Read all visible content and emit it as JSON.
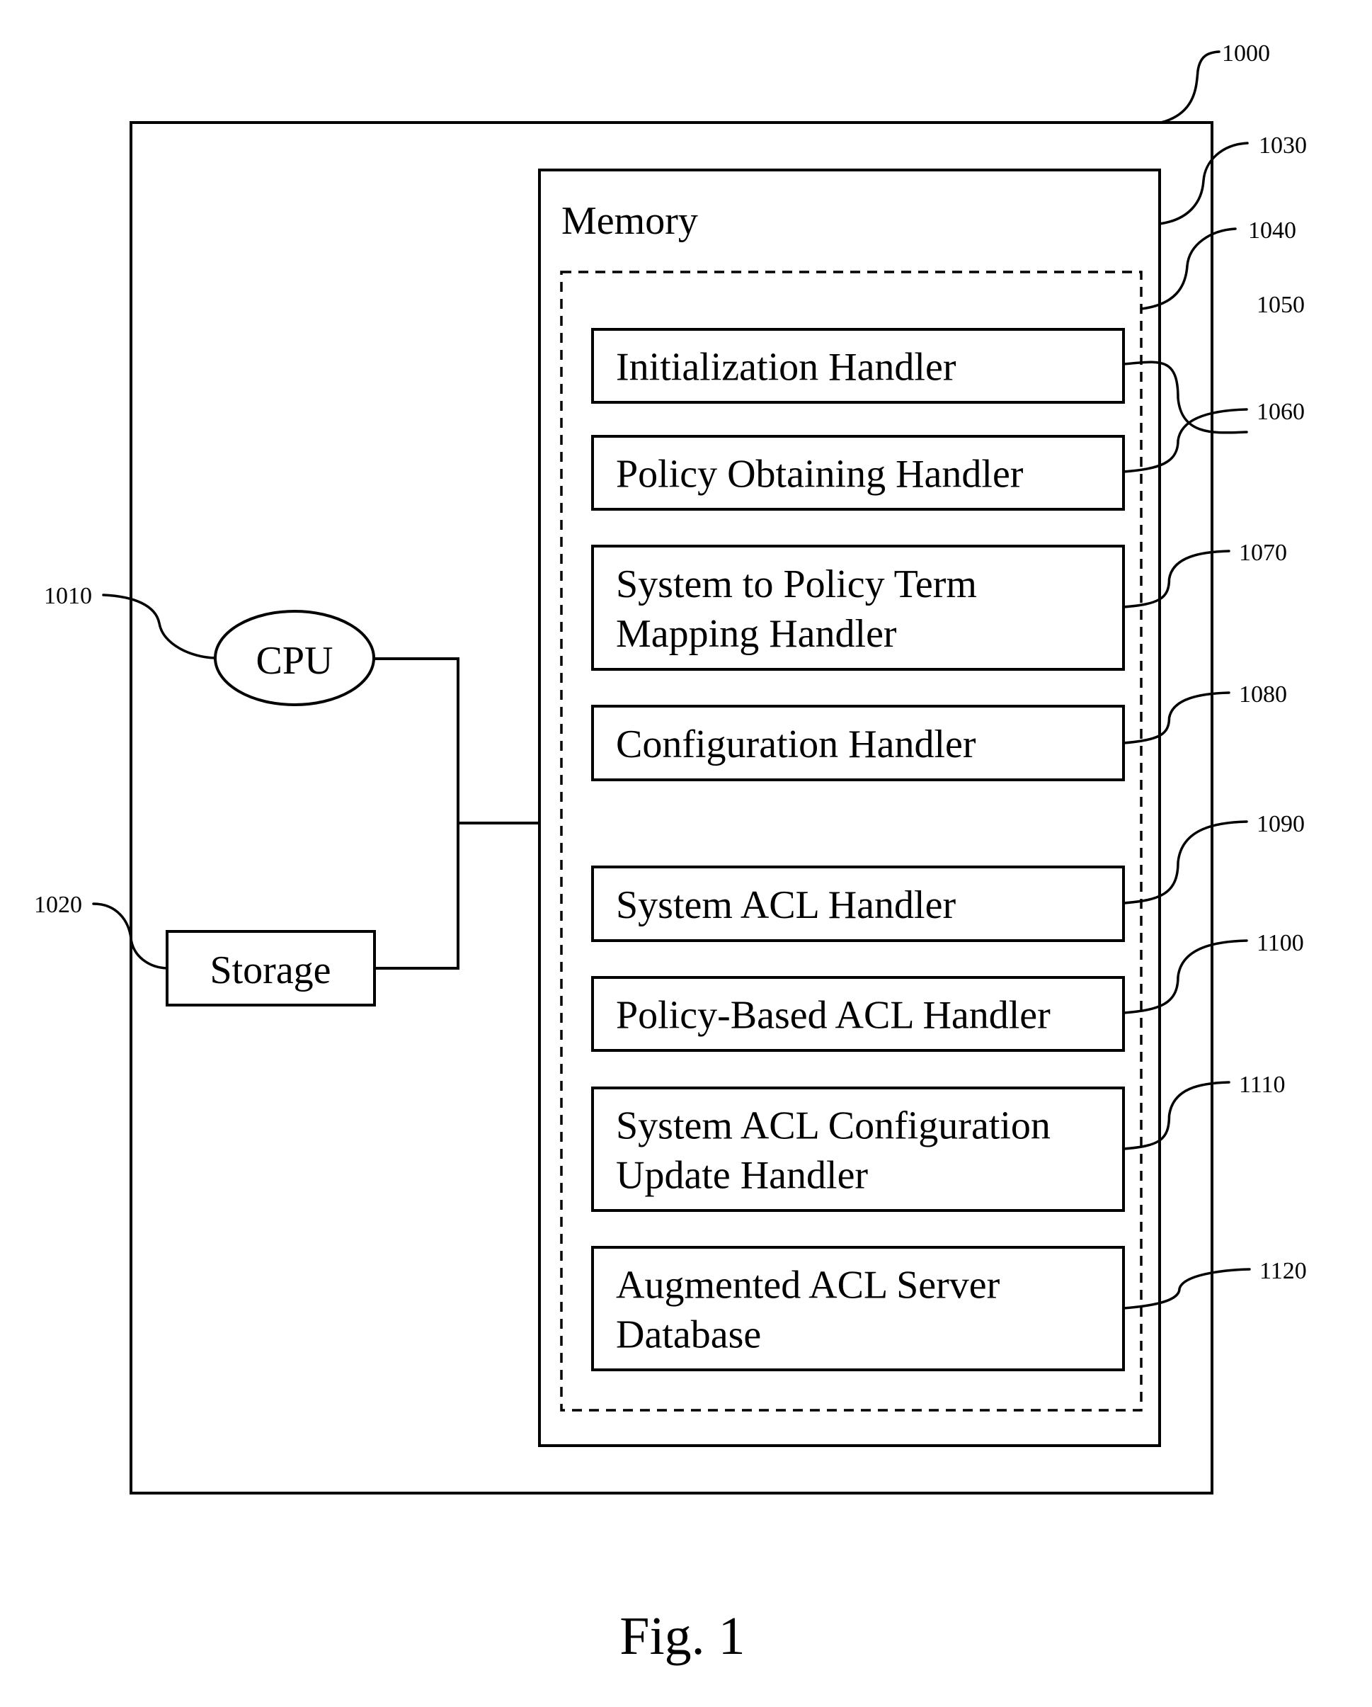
{
  "figure": {
    "caption": "Fig. 1",
    "device_ref": "1000"
  },
  "cpu": {
    "label": "CPU",
    "ref": "1010"
  },
  "storage": {
    "label": "Storage",
    "ref": "1020"
  },
  "memory": {
    "label": "Memory",
    "ref": "1030",
    "module_group_ref": "1040",
    "modules": [
      {
        "lines": [
          "Initialization Handler"
        ],
        "ref": "1050"
      },
      {
        "lines": [
          "Policy Obtaining Handler"
        ],
        "ref": "1060"
      },
      {
        "lines": [
          "System to Policy Term",
          "Mapping Handler"
        ],
        "ref": "1070"
      },
      {
        "lines": [
          "Configuration Handler"
        ],
        "ref": "1080"
      },
      {
        "lines": [
          "System ACL Handler"
        ],
        "ref": "1090"
      },
      {
        "lines": [
          "Policy-Based ACL Handler"
        ],
        "ref": "1100"
      },
      {
        "lines": [
          "System ACL Configuration",
          "Update Handler"
        ],
        "ref": "1110"
      },
      {
        "lines": [
          "Augmented ACL Server",
          "Database"
        ],
        "ref": "1120"
      }
    ]
  }
}
